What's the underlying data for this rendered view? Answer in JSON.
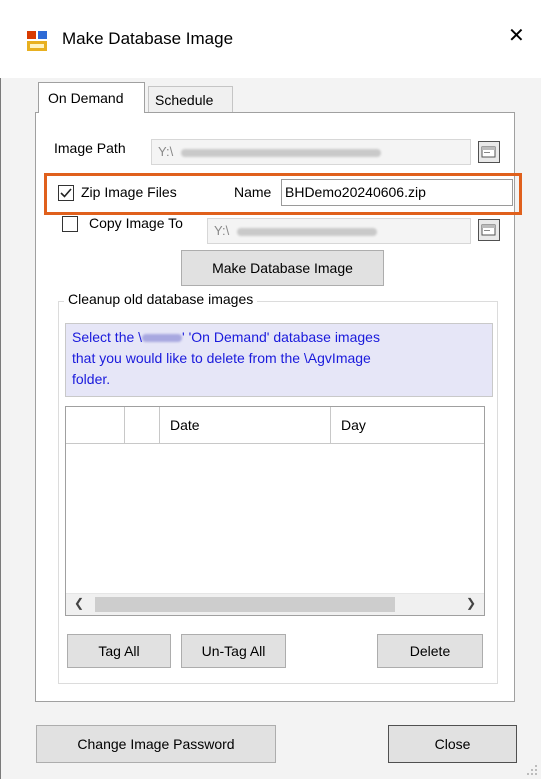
{
  "window": {
    "title": "Make Database Image",
    "close_glyph": "✕"
  },
  "tabs": [
    {
      "label": "On Demand"
    },
    {
      "label": "Schedule"
    }
  ],
  "form": {
    "image_path_label": "Image Path",
    "image_path_value": "Y:\\",
    "zip_label": "Zip Image Files",
    "zip_checked": true,
    "name_label": "Name",
    "name_value": "BHDemo20240606.zip",
    "copy_label": "Copy Image To",
    "copy_checked": false,
    "copy_value": "Y:\\",
    "make_button": "Make Database Image"
  },
  "cleanup": {
    "group_title": "Cleanup old database images",
    "info_line1_pre": "Select the \\",
    "info_line1_post": "' 'On Demand' database images",
    "info_line2": "that you would like to delete from the \\AgvImage",
    "info_line3": "folder.",
    "columns": [
      "",
      "",
      "Date",
      "Day"
    ],
    "rows": [],
    "tag_all": "Tag All",
    "untag_all": "Un-Tag All",
    "delete": "Delete"
  },
  "footer": {
    "change_password": "Change Image Password",
    "close": "Close"
  },
  "icons": {
    "app": "database-image-icon",
    "folder": "folder-browse-icon",
    "check": "checkmark-icon"
  },
  "colors": {
    "highlight": "#e0601c",
    "info_text": "#1a1adc",
    "info_bg": "#e6e6f7"
  }
}
